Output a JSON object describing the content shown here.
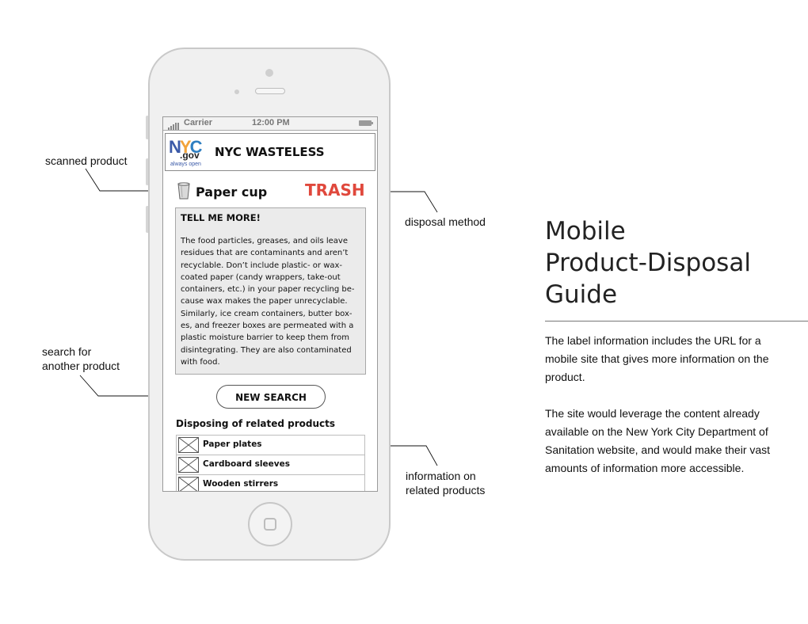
{
  "statusbar": {
    "carrier": "Carrier",
    "time": "12:00 PM"
  },
  "header": {
    "logo_nyc": "NYC",
    "logo_gov": ".gov",
    "logo_tag": "always open",
    "title": "NYC WASTELESS"
  },
  "product": {
    "name": "Paper cup",
    "disposal_method": "TRASH",
    "icon": "cup-icon"
  },
  "info": {
    "title": "TELL ME MORE!",
    "lines": [
      "The food particles, greases, and oils leave",
      "residues that are contaminants and aren’t",
      "recyclable. Don’t include plastic- or wax-",
      "coated paper (candy wrappers, take-out",
      "containers, etc.) in your paper recycling be-",
      "cause wax makes the paper unrecyclable.",
      "Similarly, ice cream containers, butter box-",
      "es, and freezer boxes are permeated with a",
      "plastic moisture barrier to keep them from",
      "disintegrating. They are also contaminated",
      "with food."
    ]
  },
  "new_search_label": "NEW SEARCH",
  "related": {
    "title": "Disposing of related products",
    "items": [
      {
        "label": "Paper plates"
      },
      {
        "label": "Cardboard sleeves"
      },
      {
        "label": "Wooden stirrers"
      }
    ]
  },
  "annotations": {
    "scanned": "scanned  product",
    "disposal": "disposal  method",
    "search_1": "search  for",
    "search_2": "another  product",
    "related_1": "information  on",
    "related_2": "related  products"
  },
  "panel": {
    "title_lines": [
      "Mobile",
      "Product-Disposal",
      "Guide"
    ],
    "para1": "The label information includes the URL for a mobile site that gives more information on the product.",
    "para2": "The site would leverage the content already available on the New York City Department of Sanitation website, and would make their vast amounts of information more accessible."
  },
  "colors": {
    "trash": "#e0483c",
    "logo_blue": "#3b5aa8",
    "logo_orange": "#f2a33a"
  }
}
